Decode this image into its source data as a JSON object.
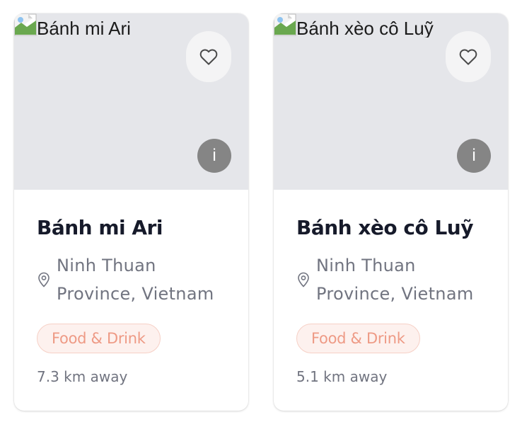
{
  "cards": [
    {
      "image_alt": "Bánh mi Ari",
      "title": "Bánh mi Ari",
      "location": "Ninh Thuan Province, Vietnam",
      "category": "Food & Drink",
      "distance": "7.3 km away",
      "info_label": "i"
    },
    {
      "image_alt": "Bánh xèo cô Luỹ",
      "title": "Bánh xèo cô Luỹ",
      "location": "Ninh Thuan Province, Vietnam",
      "category": "Food & Drink",
      "distance": "5.1 km away",
      "info_label": "i"
    }
  ],
  "icons": {
    "favorite": "heart-icon",
    "location": "map-pin-icon",
    "broken_image": "broken-image-icon"
  },
  "colors": {
    "badge_text": "#ee9a85",
    "badge_bg": "#fdf1ee",
    "badge_border": "#f6d0c6",
    "title": "#161a2a",
    "muted": "#717480",
    "media_bg": "#e5e6ea",
    "info_bg": "#858585"
  }
}
